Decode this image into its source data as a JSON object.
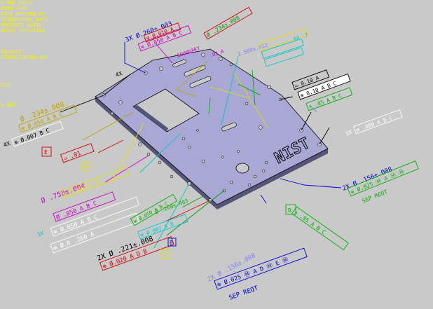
{
  "notes": {
    "color": "#f4f400",
    "lines": [
      "G AND BASIC",
      "RING TAKE",
      "DATA DEFINED BY",
      "DIMENSIONAL DATA",
      "PRESENTS BASIC",
      "RWISE SPECIFIED.",
      "DATASET",
      "DIMENSIONING AND",
      "ETS",
      "A 384"
    ]
  },
  "plate": {
    "logo": "NIST"
  },
  "callouts": {
    "top_hole": "3X Ø.260±.003",
    "top_fcf": "⊕ Ø.050 A B C",
    "top_fcf2": "⊕ Ø.010 A",
    "boundary": "BOUNDARY",
    "top_diag_a": "Ø .234±.008",
    "top_diag_b": ".03 A",
    "top_diag_c": "1.500±.012",
    "right_num": "6X .7",
    "right_small": "▭ 0.10 A",
    "right_fcf_black": "⊕ 0.10 A B C",
    "right_fcf_green": "⌖ .05 A B C",
    "fourx_top": "4X",
    "left_size": "Ø .234±.008",
    "left_fcf": "⊕ Ø.050 A B C",
    "left_4x": "4X",
    "left_fcf2": "⊕ Ø.007 B C",
    "datum_e": "E",
    "flat": "▱ .01",
    "datum_a": "A",
    "threex_right": "3X",
    "right_fcf_box": "⊕ .080 A B C",
    "twox_right": "2X Ø .156±.008",
    "twox_right_fcf": "⊕ Ø.025 Ⓜ A Ⓜ Ⓜ",
    "twox_right_sep": "SEP REQT",
    "yel_size": "Ø .750±.004",
    "yel_fcf": "⊕ Ø.004 A Ⓜ",
    "mag_size": "Ø .050 A B C",
    "threex_left": "3X",
    "white_fcf1": "⊕ Ø.050 A B C",
    "white_fcf2": "⊕ Ø.0 .260 A",
    "black_2x": "2X Ø .221±.008",
    "red_fcf": "⊕ Ø.020 A D B",
    "teal_fcf": "⊕ Ø.002 A B",
    "datum_b": "B",
    "datum_c": "C",
    "datum_d": "D",
    "green_fcf": "⌖ .05 A B C",
    "blue_size": "2X Ø .156±.008",
    "blue_fcf": "⊕ Ø.025 Ⓜ A D Ⓜ E Ⓜ",
    "blue_sep": "SEP REQT",
    "green_size": "Ø .260±.003",
    "green_fcf2": "⊕ Ø.050 A B C"
  }
}
